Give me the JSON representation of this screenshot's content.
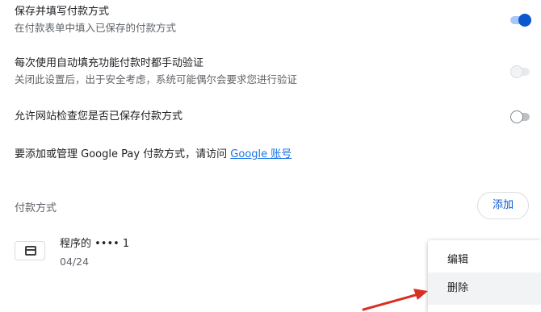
{
  "settings": {
    "save_fill": {
      "title": "保存并填写付款方式",
      "description": "在付款表单中填入已保存的付款方式",
      "enabled": true
    },
    "verify": {
      "title": "每次使用自动填充功能付款时都手动验证",
      "description": "关闭此设置后，出于安全考虑，系统可能偶尔会要求您进行验证",
      "enabled": false
    },
    "allow_check": {
      "title": "允许网站检查您是否已保存付款方式",
      "enabled": false
    }
  },
  "google_pay": {
    "text": "要添加或管理 Google Pay 付款方式，请访问",
    "link": "Google 账号"
  },
  "payment_methods": {
    "heading": "付款方式",
    "add_label": "添加",
    "cards": [
      {
        "name": "程序的 •••• 1",
        "expiry": "04/24"
      }
    ]
  },
  "context_menu": {
    "items": [
      "编辑",
      "删除"
    ]
  },
  "colors": {
    "accent": "#0b57d0",
    "arrow": "#d93025"
  }
}
